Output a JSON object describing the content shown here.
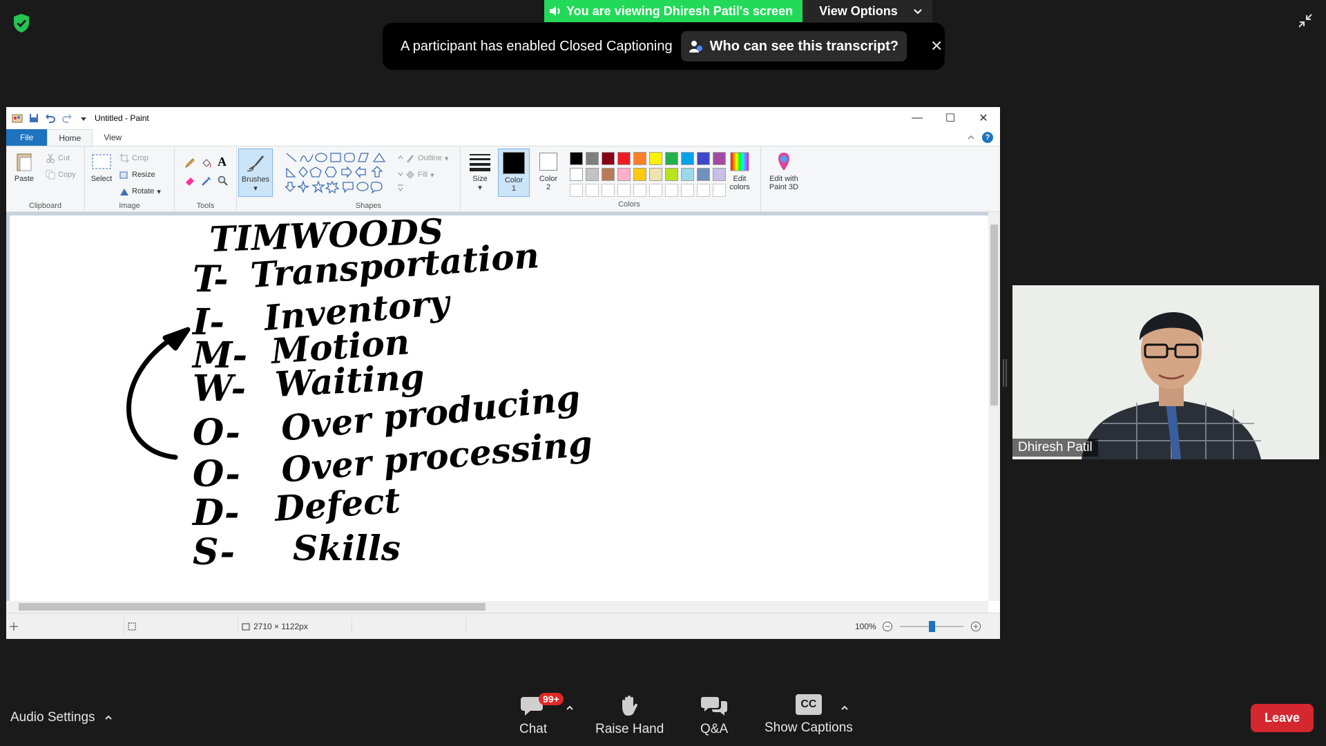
{
  "zoom": {
    "viewing_banner": "You are viewing Dhiresh Patil's screen",
    "view_options": "View Options",
    "cc_notice": "A participant has enabled Closed Captioning",
    "cc_who": "Who can see this transcript?",
    "close_glyph": "✕"
  },
  "paint": {
    "title": "Untitled - Paint",
    "tabs": [
      "File",
      "Home",
      "View"
    ],
    "clipboard": {
      "paste": "Paste",
      "cut": "Cut",
      "copy": "Copy",
      "label": "Clipboard"
    },
    "image": {
      "select": "Select",
      "crop": "Crop",
      "resize": "Resize",
      "rotate": "Rotate",
      "label": "Image"
    },
    "tools": {
      "label": "Tools",
      "brushes": "Brushes"
    },
    "shapes": {
      "outline": "Outline",
      "fill": "Fill",
      "label": "Shapes"
    },
    "size": "Size",
    "color1": "Color 1",
    "color2": "Color 2",
    "colors_label": "Colors",
    "edit_colors": "Edit colors",
    "edit_paint3d": "Edit with Paint 3D",
    "palette_row1": [
      "#000000",
      "#7f7f7f",
      "#880015",
      "#ed1c24",
      "#ff7f27",
      "#fff200",
      "#22b14c",
      "#00a2e8",
      "#3f48cc",
      "#a349a4"
    ],
    "palette_row2": [
      "#ffffff",
      "#c3c3c3",
      "#b97a57",
      "#ffaec9",
      "#ffc90e",
      "#efe4b0",
      "#b5e61d",
      "#99d9ea",
      "#7092be",
      "#c8bfe7"
    ],
    "palette_row3": [
      "#ffffff",
      "#ffffff",
      "#ffffff",
      "#ffffff",
      "#ffffff",
      "#ffffff",
      "#ffffff",
      "#ffffff",
      "#ffffff",
      "#ffffff"
    ],
    "canvas_size": "2710 × 1122px",
    "zoom_level": "100%",
    "handwriting": {
      "title": "TIMWOODS",
      "lines": [
        {
          "letter": "T-",
          "word": "Transportation"
        },
        {
          "letter": "I-",
          "word": "Inventory"
        },
        {
          "letter": "M-",
          "word": "Motion"
        },
        {
          "letter": "W-",
          "word": "Waiting"
        },
        {
          "letter": "O-",
          "word": "Over producing"
        },
        {
          "letter": "O-",
          "word": "Over processing"
        },
        {
          "letter": "D-",
          "word": "Defect"
        },
        {
          "letter": "S-",
          "word": "Skills"
        }
      ]
    }
  },
  "video": {
    "name": "Dhiresh Patil"
  },
  "toolbar": {
    "audio_settings": "Audio Settings",
    "chat": "Chat",
    "chat_badge": "99+",
    "raise_hand": "Raise Hand",
    "qa": "Q&A",
    "show_captions": "Show Captions",
    "cc_label": "CC",
    "leave": "Leave"
  }
}
